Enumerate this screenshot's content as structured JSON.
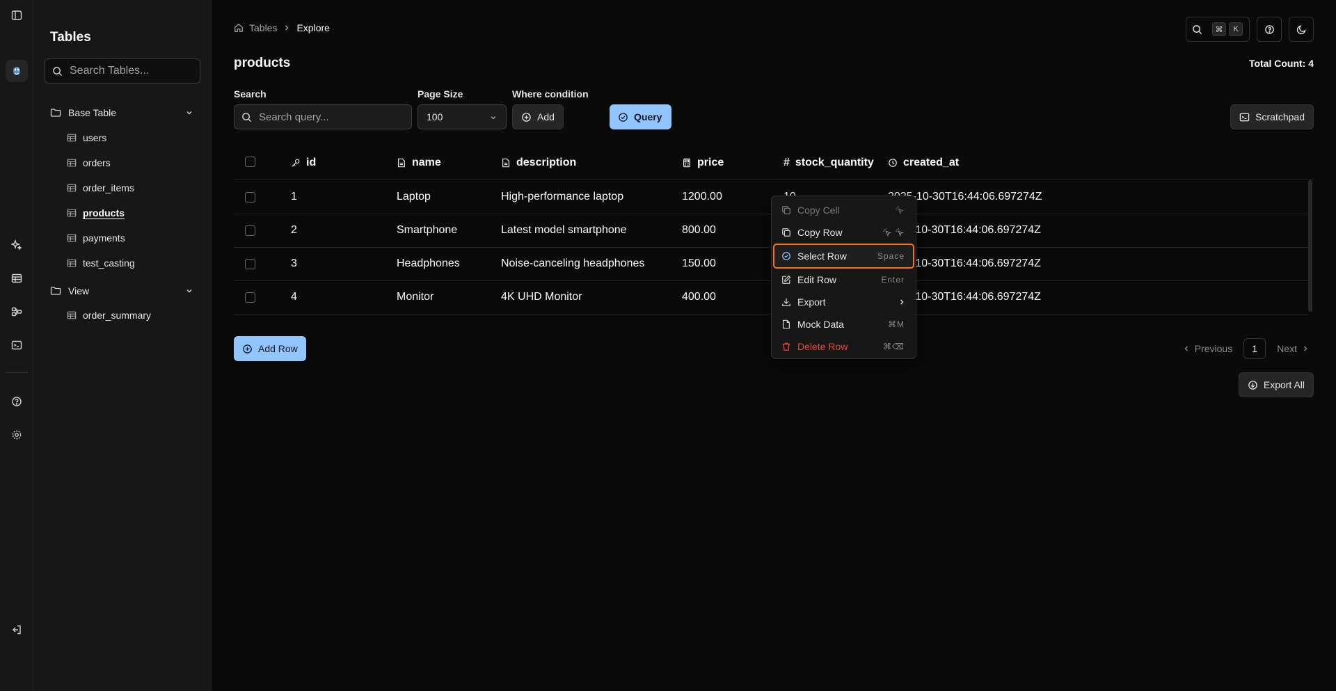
{
  "sidebar": {
    "title": "Tables",
    "search_placeholder": "Search Tables...",
    "groups": [
      {
        "label": "Base Table",
        "items": [
          "users",
          "orders",
          "order_items",
          "products",
          "payments",
          "test_casting"
        ]
      },
      {
        "label": "View",
        "items": [
          "order_summary"
        ]
      }
    ],
    "active_item": "products"
  },
  "breadcrumb": {
    "root": "Tables",
    "current": "Explore"
  },
  "header": {
    "search_shortcut_mod": "⌘",
    "search_shortcut_key": "K"
  },
  "page": {
    "title": "products",
    "total_count": "Total Count: 4"
  },
  "filters": {
    "search_label": "Search",
    "search_placeholder": "Search query...",
    "page_size_label": "Page Size",
    "page_size_value": "100",
    "where_label": "Where condition",
    "add_label": "Add",
    "query_label": "Query",
    "scratchpad_label": "Scratchpad"
  },
  "table": {
    "columns": [
      "id",
      "name",
      "description",
      "price",
      "stock_quantity",
      "created_at"
    ],
    "rows": [
      [
        "1",
        "Laptop",
        "High-performance laptop",
        "1200.00",
        "10",
        "2025-10-30T16:44:06.697274Z"
      ],
      [
        "2",
        "Smartphone",
        "Latest model smartphone",
        "800.00",
        "",
        "-10-30T16:44:06.697274Z"
      ],
      [
        "3",
        "Headphones",
        "Noise-canceling headphones",
        "150.00",
        "",
        "-10-30T16:44:06.697274Z"
      ],
      [
        "4",
        "Monitor",
        "4K UHD Monitor",
        "400.00",
        "",
        "-10-30T16:44:06.697274Z"
      ]
    ]
  },
  "actions": {
    "add_row": "Add Row",
    "export_all": "Export All",
    "previous": "Previous",
    "next": "Next",
    "page": "1"
  },
  "context_menu": {
    "items": [
      {
        "label": "Copy Cell",
        "shortcut": "",
        "icon": "copy-icon",
        "state": "disabled"
      },
      {
        "label": "Copy Row",
        "shortcut": "",
        "icon": "copy-icon",
        "state": "normal"
      },
      {
        "label": "Select Row",
        "shortcut": "Space",
        "icon": "check-circle-icon",
        "state": "focused"
      },
      {
        "label": "Edit Row",
        "shortcut": "Enter",
        "icon": "edit-icon",
        "state": "normal"
      },
      {
        "label": "Export",
        "shortcut": "",
        "icon": "download-icon",
        "state": "submenu"
      },
      {
        "label": "Mock Data",
        "shortcut": "⌘M",
        "icon": "document-icon",
        "state": "normal"
      },
      {
        "label": "Delete Row",
        "shortcut": "⌘⌫",
        "icon": "trash-icon",
        "state": "danger"
      }
    ]
  },
  "colors": {
    "accent_blue": "#93c5fd",
    "focus_orange": "#f97316",
    "danger_red": "#ef4444",
    "background": "#0a0a0a",
    "sidebar": "#171717"
  }
}
